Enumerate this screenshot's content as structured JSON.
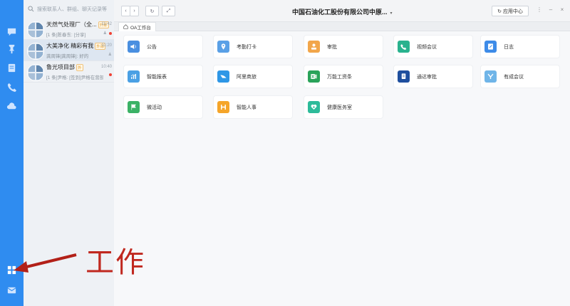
{
  "conversations": {
    "search_placeholder": "搜索联系人、群组、聊天记录等",
    "items": [
      {
        "title": "天然气处理厂（全...",
        "tag": "外部",
        "time": "11:42",
        "preview": "[1 条]陈春东: [分享]",
        "unread": true
      },
      {
        "title": "大美净化 精彩有我",
        "tag": "外部",
        "time": "11:20",
        "preview": "龚周锋[龚周锋]: 好的",
        "unread": false
      },
      {
        "title": "鲁光项目部",
        "tag": "外",
        "time": "10:40",
        "preview": "[1 条]尹格: [签到]尹格在营部...",
        "unread": true
      }
    ]
  },
  "window": {
    "title": "中国石油化工股份有限公司中原...",
    "title_caret": "▾",
    "app_center": "应用中心",
    "tab": "OA工作台"
  },
  "apps": [
    {
      "label": "公告",
      "icon": "speaker-icon",
      "color": "#4a8fe0"
    },
    {
      "label": "考勤打卡",
      "icon": "location-pin-icon",
      "color": "#5aa0e6"
    },
    {
      "label": "审批",
      "icon": "person-stamp-icon",
      "color": "#f2a64a"
    },
    {
      "label": "视频会议",
      "icon": "video-call-icon",
      "color": "#29b28e"
    },
    {
      "label": "日志",
      "icon": "notebook-pen-icon",
      "color": "#3d8be8"
    },
    {
      "label": "智能报表",
      "icon": "bar-chart-icon",
      "color": "#4aa0e4"
    },
    {
      "label": "阿里商旅",
      "icon": "plane-tail-icon",
      "color": "#2f97e6"
    },
    {
      "label": "万能工资条",
      "icon": "excel-sheet-icon",
      "color": "#2aa35a"
    },
    {
      "label": "通达审批",
      "icon": "document-approval-icon",
      "color": "#1f4f9e"
    },
    {
      "label": "有成会议",
      "icon": "meeting-y-icon",
      "color": "#6fb5e8"
    },
    {
      "label": "微活动",
      "icon": "flag-activity-icon",
      "color": "#3bb266"
    },
    {
      "label": "智能人事",
      "icon": "hr-h-icon",
      "color": "#f5a52a"
    },
    {
      "label": "健康医务室",
      "icon": "medical-heart-icon",
      "color": "#2dbb9a"
    }
  ],
  "annotation": {
    "label": "工作"
  },
  "colors": {
    "rail": "#2f8cf0",
    "annotation": "#c0281f"
  }
}
